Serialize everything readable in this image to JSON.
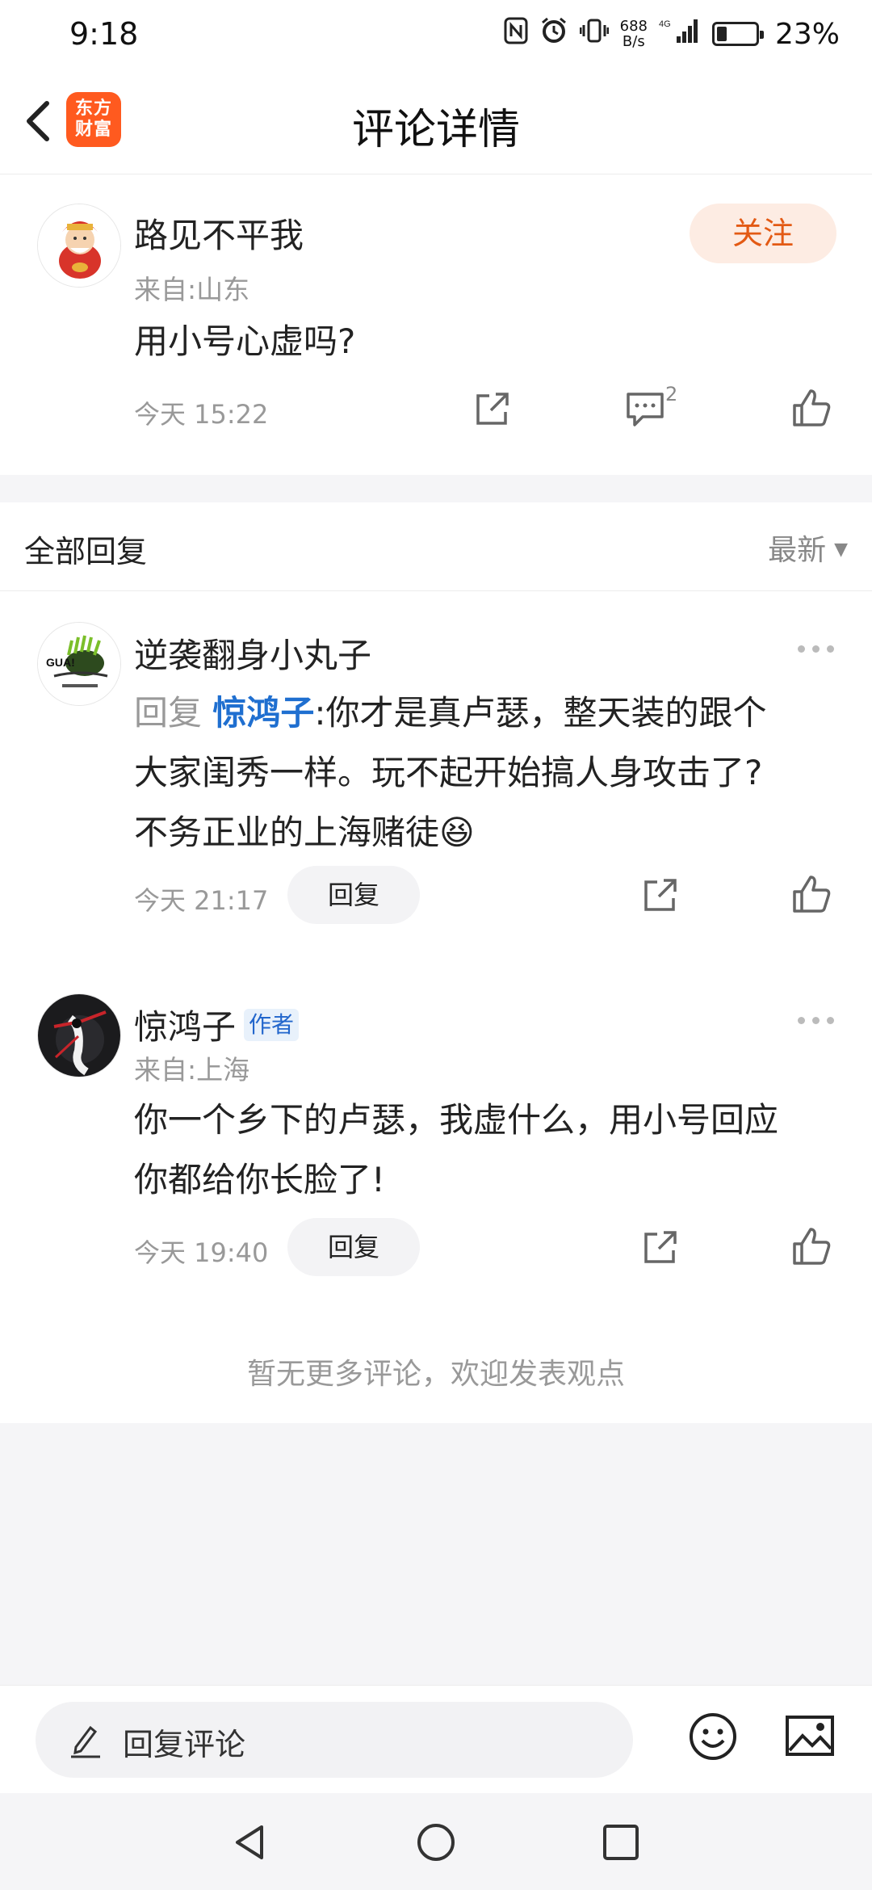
{
  "status_bar": {
    "time": "9:18",
    "net_speed_value": "688",
    "net_speed_unit": "B/s",
    "network": "4G",
    "battery": "23%",
    "battery_level": 0.23
  },
  "header": {
    "back_icon": "chevron-left-icon",
    "logo_line1": "东方",
    "logo_line2": "财富",
    "title": "评论详情"
  },
  "main_comment": {
    "username": "路见不平我",
    "location": "来自:山东",
    "text": "用小号心虚吗?",
    "time": "今天 15:22",
    "follow_label": "关注",
    "comment_count": "2",
    "colors": {
      "follow_bg": "#fdece3",
      "follow_text": "#e35a14"
    }
  },
  "replies": {
    "header_label": "全部回复",
    "sort_label": "最新",
    "items": [
      {
        "username": "逆袭翻身小丸子",
        "reply_prefix": "回复",
        "reply_target": "惊鸿子",
        "text_line1": ":你才是真卢瑟，整天装的跟个",
        "text_line2": "大家闺秀一样。玩不起开始搞人身攻击了?",
        "text_line3": "不务正业的上海赌徒",
        "emoji": "😆",
        "time": "今天 21:17",
        "reply_label": "回复"
      },
      {
        "username": "惊鸿子",
        "author_tag": "作者",
        "location": "来自:上海",
        "text_line1": "你一个乡下的卢瑟，我虚什么，用小号回应",
        "text_line2": "你都给你长脸了!",
        "time": "今天 19:40",
        "reply_label": "回复"
      }
    ],
    "no_more_text": "暂无更多评论，欢迎发表观点"
  },
  "input_bar": {
    "placeholder": "回复评论",
    "emoji_icon": "smile-icon",
    "image_icon": "image-icon"
  },
  "colors": {
    "accent": "#ff5a1f",
    "link_blue": "#1f6fd0",
    "muted_text": "#999999"
  }
}
